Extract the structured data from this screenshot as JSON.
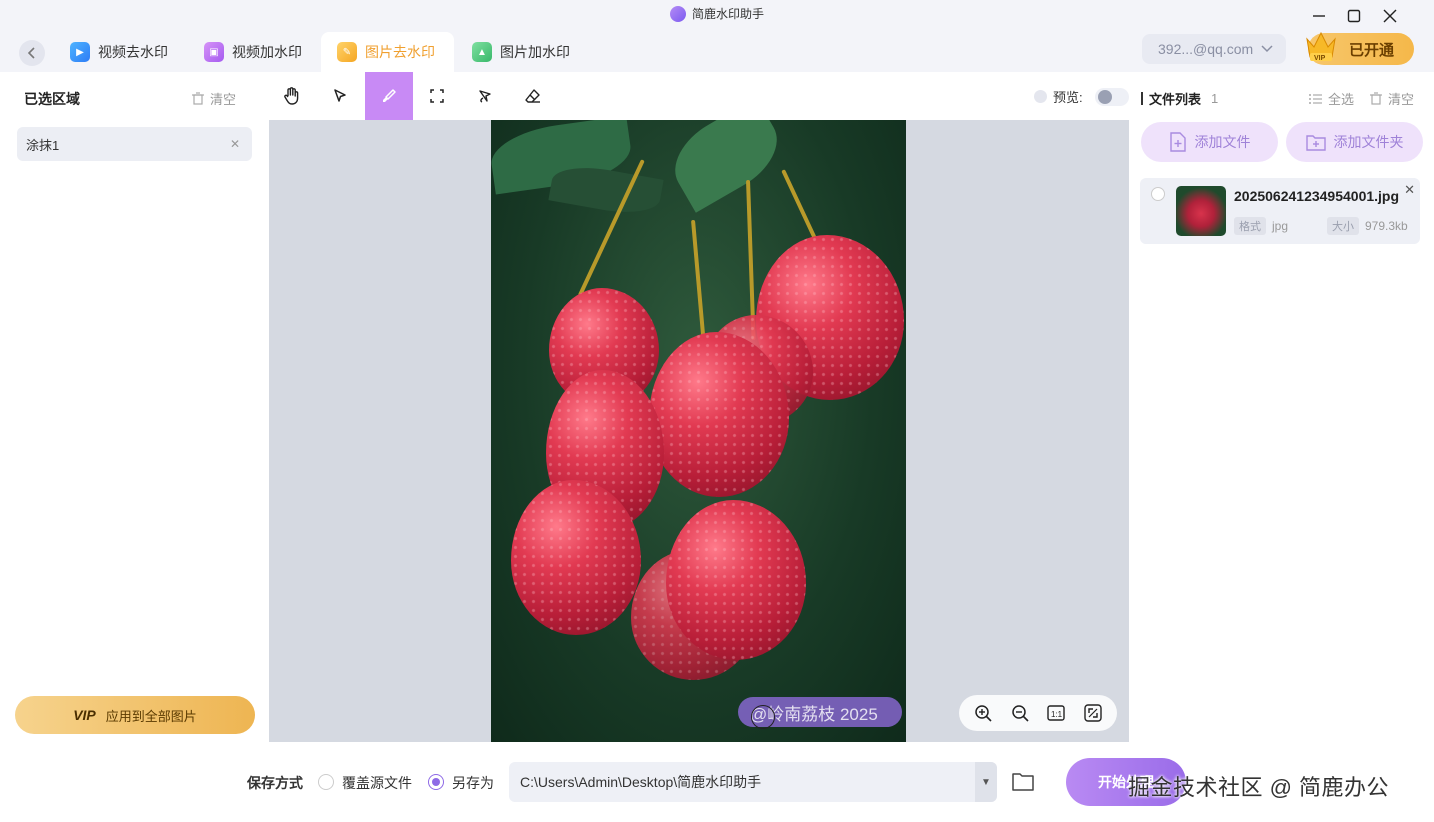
{
  "app": {
    "title": "简鹿水印助手",
    "window_controls": [
      "minimize",
      "maximize",
      "close"
    ]
  },
  "tabs": [
    {
      "label": "视频去水印",
      "active": false,
      "icon": "video-remove-icon"
    },
    {
      "label": "视频加水印",
      "active": false,
      "icon": "video-add-icon"
    },
    {
      "label": "图片去水印",
      "active": true,
      "icon": "image-remove-icon"
    },
    {
      "label": "图片加水印",
      "active": false,
      "icon": "image-add-icon"
    }
  ],
  "account": {
    "email": "392...@qq.com",
    "vip_label": "已开通"
  },
  "left_panel": {
    "title": "已选区域",
    "clear_label": "清空",
    "regions": [
      {
        "label": "涂抹1"
      }
    ],
    "apply_all": {
      "vip": "VIP",
      "label": "应用到全部图片"
    }
  },
  "toolbar": {
    "tools": [
      "hand-tool",
      "select-tool",
      "brush-tool",
      "rect-select-tool",
      "lasso-tool",
      "eraser-tool"
    ],
    "active_tool": "brush-tool",
    "preview_label": "预览:",
    "preview_enabled": false
  },
  "canvas": {
    "watermark_text": "@岭南荔枝 2025",
    "zoom_controls": [
      "zoom-in",
      "zoom-out",
      "actual-size",
      "fit-screen"
    ],
    "actual_size_label": "1:1"
  },
  "right_panel": {
    "title": "文件列表",
    "count": "1",
    "select_all_label": "全选",
    "clear_label": "清空",
    "add_file_label": "添加文件",
    "add_folder_label": "添加文件夹",
    "files": [
      {
        "name": "202506241234954001.jpg",
        "format_tag": "格式",
        "format": "jpg",
        "size_tag": "大小",
        "size": "979.3kb"
      }
    ]
  },
  "bottom": {
    "save_mode_label": "保存方式",
    "options": [
      {
        "label": "覆盖源文件",
        "checked": false
      },
      {
        "label": "另存为",
        "checked": true
      }
    ],
    "path": "C:\\Users\\Admin\\Desktop\\简鹿水印助手",
    "start_label": "开始处理",
    "site_watermark": "掘金技术社区 @ 简鹿办公"
  },
  "colors": {
    "accent": "#c88af5",
    "active_tab_text": "#f0a030",
    "vip_gold": "#f5b84a"
  }
}
